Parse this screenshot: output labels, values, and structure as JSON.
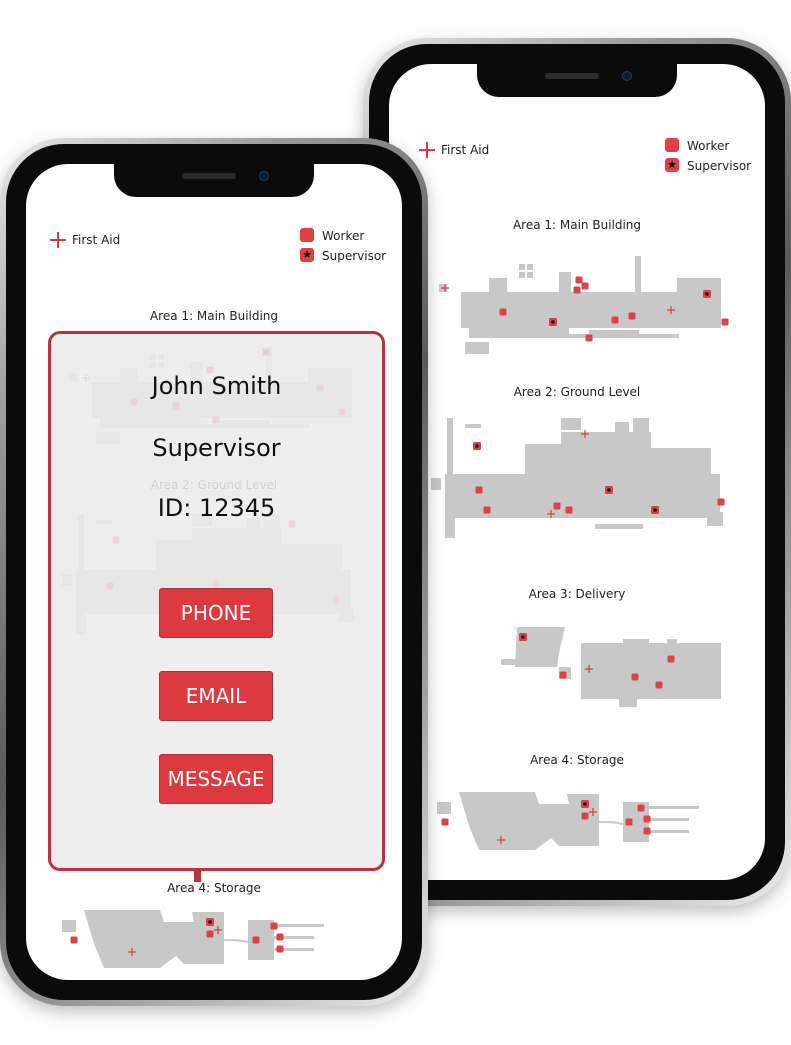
{
  "legend": {
    "first_aid": "First Aid",
    "worker": "Worker",
    "supervisor": "Supervisor"
  },
  "areas": [
    {
      "title": "Area 1: Main Building"
    },
    {
      "title": "Area 2: Ground Level"
    },
    {
      "title": "Area 3: Delivery"
    },
    {
      "title": "Area 4: Storage"
    }
  ],
  "contact_card": {
    "name": "John Smith",
    "role": "Supervisor",
    "id_text": "ID: 12345",
    "phone_label": "PHONE",
    "email_label": "EMAIL",
    "message_label": "MESSAGE"
  },
  "colors": {
    "accent": "#dc3a3e",
    "card_border": "#b8333a",
    "map_fill": "#c8c8c8"
  },
  "icons": {
    "first_aid": "red-plus-icon",
    "worker": "red-square-icon",
    "supervisor": "star-icon"
  }
}
